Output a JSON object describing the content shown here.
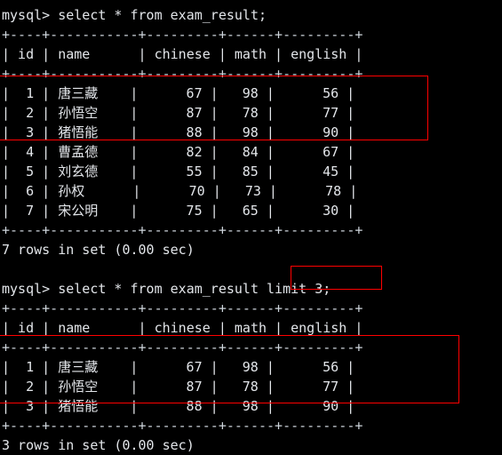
{
  "terminal": {
    "background_color": "#000000",
    "text_color": "#e3e6ea",
    "annotation_color": "#ff0000",
    "prompt": "mysql> "
  },
  "session": {
    "blocks": [
      {
        "command_line": "mysql> select * from exam_result;",
        "top_rule": "+----+-----------+---------+------+---------+",
        "header_row": "| id | name      | chinese | math | english |",
        "mid_rule": "+----+-----------+---------+------+---------+",
        "rows": [
          "|  1 | 唐三藏    |      67 |   98 |      56 |",
          "|  2 | 孙悟空    |      87 |   78 |      77 |",
          "|  3 | 猪悟能    |      88 |   98 |      90 |",
          "|  4 | 曹孟德    |      82 |   84 |      67 |",
          "|  5 | 刘玄德    |      55 |   85 |      45 |",
          "|  6 | 孙权      |      70 |   73 |      78 |",
          "|  7 | 宋公明    |      75 |   65 |      30 |"
        ],
        "bottom_rule": "+----+-----------+---------+------+---------+",
        "status": "7 rows in set (0.00 sec)"
      },
      {
        "command_prefix": "mysql> select * from exam_result ",
        "command_highlight": "limit 3;",
        "top_rule": "+----+-----------+---------+------+---------+",
        "header_row": "| id | name      | chinese | math | english |",
        "mid_rule": "+----+-----------+---------+------+---------+",
        "rows": [
          "|  1 | 唐三藏    |      67 |   98 |      56 |",
          "|  2 | 孙悟空    |      87 |   78 |      77 |",
          "|  3 | 猪悟能    |      88 |   98 |      90 |"
        ],
        "bottom_rule": "+----+-----------+---------+------+---------+",
        "status": "3 rows in set (0.00 sec)"
      }
    ]
  },
  "table": {
    "name": "exam_result",
    "columns": [
      "id",
      "name",
      "chinese",
      "math",
      "english"
    ],
    "all_rows": [
      {
        "id": 1,
        "name": "唐三藏",
        "chinese": 67,
        "math": 98,
        "english": 56
      },
      {
        "id": 2,
        "name": "孙悟空",
        "chinese": 87,
        "math": 78,
        "english": 77
      },
      {
        "id": 3,
        "name": "猪悟能",
        "chinese": 88,
        "math": 98,
        "english": 90
      },
      {
        "id": 4,
        "name": "曹孟德",
        "chinese": 82,
        "math": 84,
        "english": 67
      },
      {
        "id": 5,
        "name": "刘玄德",
        "chinese": 55,
        "math": 85,
        "english": 45
      },
      {
        "id": 6,
        "name": "孙权",
        "chinese": 70,
        "math": 73,
        "english": 78
      },
      {
        "id": 7,
        "name": "宋公明",
        "chinese": 75,
        "math": 65,
        "english": 30
      }
    ],
    "limited_rows": [
      {
        "id": 1,
        "name": "唐三藏",
        "chinese": 67,
        "math": 98,
        "english": 56
      },
      {
        "id": 2,
        "name": "孙悟空",
        "chinese": 87,
        "math": 78,
        "english": 77
      },
      {
        "id": 3,
        "name": "猪悟能",
        "chinese": 88,
        "math": 98,
        "english": 90
      }
    ]
  },
  "blank": " "
}
